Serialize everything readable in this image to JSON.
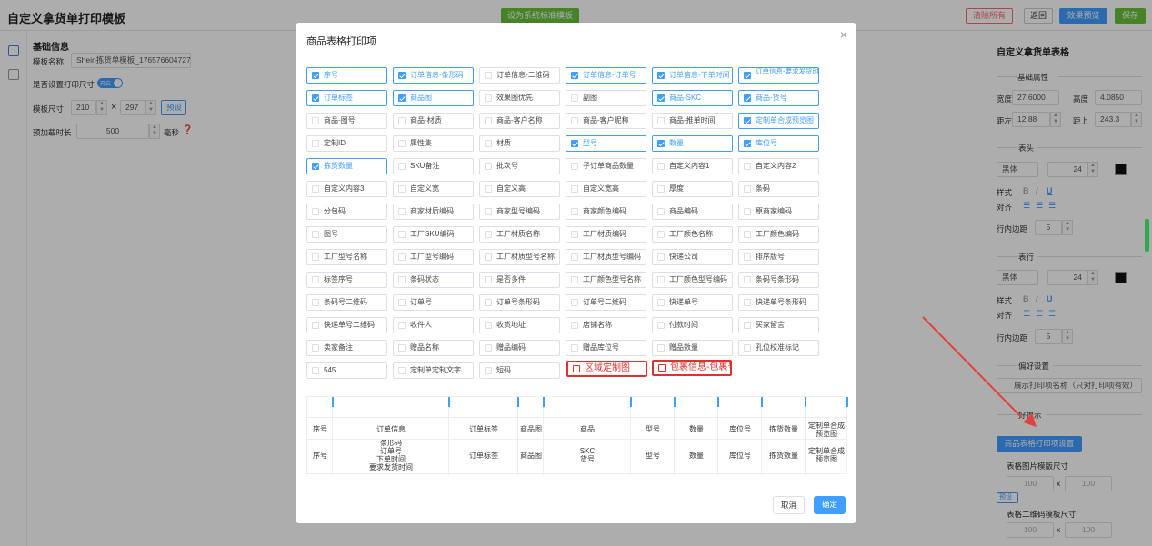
{
  "app": {
    "title": "自定义拿货单打印模板",
    "save_as_standard": "设为系统标准模板",
    "clear_all": "清除所有",
    "back": "返回",
    "preview": "效果预览",
    "save": "保存"
  },
  "left": {
    "section": "基础信息",
    "template_name_label": "模板名称",
    "template_name_value": "Shein拣货单模板_176576604727",
    "print_size_label": "是否设置打印尺寸",
    "toggle": "开启",
    "size_label": "模板尺寸",
    "width": "210",
    "height": "297",
    "preset": "预设",
    "preload_label": "预加载时长",
    "preload_value": "500",
    "ms": "毫秒"
  },
  "right": {
    "title": "自定义拿货单表格",
    "basic": "基础属性",
    "width_label": "宽度",
    "width_value": "27.6000",
    "height_label": "高度",
    "height_value": "4.0850",
    "left_label": "距左",
    "left_value": "12.88",
    "top_label": "距上",
    "top_value": "243.3",
    "header": "表头",
    "font": "黑体",
    "font_size": "24",
    "style_label": "样式",
    "align_label": "对齐",
    "padding_label": "行内边距",
    "padding_value": "5",
    "row": "表行",
    "pref": "偏好设置",
    "show_name": "展示打印项名称（只对打印项有效）",
    "hint": "好提示",
    "table_setting": "商品表格打印项设置",
    "img_size": "表格图片模版尺寸",
    "qr_size": "表格二维码模板尺寸",
    "w100": "100",
    "h100": "100",
    "x": "x",
    "preset": "预设"
  },
  "modal": {
    "title": "商品表格打印项",
    "close": "×",
    "cancel": "取消",
    "ok": "确定",
    "items": [
      {
        "label": "序号",
        "checked": true
      },
      {
        "label": "订单信息-条形码",
        "checked": true
      },
      {
        "label": "订单信息-二维码",
        "checked": false
      },
      {
        "label": "订单信息-订单号",
        "checked": true
      },
      {
        "label": "订单信息-下单时间",
        "checked": true
      },
      {
        "label": "订单信息-要求发货时间",
        "checked": true
      },
      {
        "label": "订单标签",
        "checked": true
      },
      {
        "label": "商品图",
        "checked": true
      },
      {
        "label": "效果图优先",
        "checked": false
      },
      {
        "label": "副图",
        "checked": false
      },
      {
        "label": "商品-SKC",
        "checked": true
      },
      {
        "label": "商品-货号",
        "checked": true
      },
      {
        "label": "商品-图号",
        "checked": false
      },
      {
        "label": "商品-材质",
        "checked": false
      },
      {
        "label": "商品-客户名称",
        "checked": false
      },
      {
        "label": "商品-客户昵称",
        "checked": false
      },
      {
        "label": "商品-推单时间",
        "checked": false
      },
      {
        "label": "定制单合成预览图",
        "checked": true
      },
      {
        "label": "定制ID",
        "checked": false
      },
      {
        "label": "属性集",
        "checked": false
      },
      {
        "label": "材质",
        "checked": false
      },
      {
        "label": "型号",
        "checked": true
      },
      {
        "label": "数量",
        "checked": true
      },
      {
        "label": "库位号",
        "checked": true
      },
      {
        "label": "拣货数量",
        "checked": true
      },
      {
        "label": "SKU备注",
        "checked": false
      },
      {
        "label": "批次号",
        "checked": false
      },
      {
        "label": "子订单商品数量",
        "checked": false
      },
      {
        "label": "自定义内容1",
        "checked": false
      },
      {
        "label": "自定义内容2",
        "checked": false
      },
      {
        "label": "自定义内容3",
        "checked": false
      },
      {
        "label": "自定义宽",
        "checked": false
      },
      {
        "label": "自定义高",
        "checked": false
      },
      {
        "label": "自定义宽高",
        "checked": false
      },
      {
        "label": "厚度",
        "checked": false
      },
      {
        "label": "条码",
        "checked": false
      },
      {
        "label": "分包码",
        "checked": false
      },
      {
        "label": "商家材质编码",
        "checked": false
      },
      {
        "label": "商家型号编码",
        "checked": false
      },
      {
        "label": "商家颜色编码",
        "checked": false
      },
      {
        "label": "商品编码",
        "checked": false
      },
      {
        "label": "原商家编码",
        "checked": false
      },
      {
        "label": "图号",
        "checked": false
      },
      {
        "label": "工厂SKU编码",
        "checked": false
      },
      {
        "label": "工厂材质名称",
        "checked": false
      },
      {
        "label": "工厂材质编码",
        "checked": false
      },
      {
        "label": "工厂颜色名称",
        "checked": false
      },
      {
        "label": "工厂颜色编码",
        "checked": false
      },
      {
        "label": "工厂型号名称",
        "checked": false
      },
      {
        "label": "工厂型号编码",
        "checked": false
      },
      {
        "label": "工厂材质型号名称",
        "checked": false
      },
      {
        "label": "工厂材质型号编码",
        "checked": false
      },
      {
        "label": "快递公司",
        "checked": false
      },
      {
        "label": "排序版号",
        "checked": false
      },
      {
        "label": "标签序号",
        "checked": false
      },
      {
        "label": "条码状态",
        "checked": false
      },
      {
        "label": "是否多件",
        "checked": false
      },
      {
        "label": "工厂颜色型号名称",
        "checked": false
      },
      {
        "label": "工厂颜色型号编码",
        "checked": false
      },
      {
        "label": "条码号条形码",
        "checked": false
      },
      {
        "label": "条码号二维码",
        "checked": false
      },
      {
        "label": "订单号",
        "checked": false
      },
      {
        "label": "订单号条形码",
        "checked": false
      },
      {
        "label": "订单号二维码",
        "checked": false
      },
      {
        "label": "快递单号",
        "checked": false
      },
      {
        "label": "快递单号条形码",
        "checked": false
      },
      {
        "label": "快递单号二维码",
        "checked": false
      },
      {
        "label": "收件人",
        "checked": false
      },
      {
        "label": "收货地址",
        "checked": false
      },
      {
        "label": "店铺名称",
        "checked": false
      },
      {
        "label": "付款时间",
        "checked": false
      },
      {
        "label": "买家留言",
        "checked": false
      },
      {
        "label": "卖家备注",
        "checked": false
      },
      {
        "label": "赠品名称",
        "checked": false
      },
      {
        "label": "赠品编码",
        "checked": false
      },
      {
        "label": "赠品库位号",
        "checked": false
      },
      {
        "label": "赠品数量",
        "checked": false
      },
      {
        "label": "孔位校准标记",
        "checked": false
      },
      {
        "label": "545",
        "checked": false
      },
      {
        "label": "定制单定制文字",
        "checked": false
      },
      {
        "label": "短码",
        "checked": false
      },
      {
        "label": "区域定制图",
        "checked": false
      },
      {
        "label": "包裹信息-包裹号",
        "checked": false
      }
    ],
    "preview_cols": [
      {
        "header": "序号",
        "cell": "序号"
      },
      {
        "header": "订单信息",
        "cell": "条形码\n订单号\n下单时间\n要求发货时间"
      },
      {
        "header": "订单标签",
        "cell": "订单标签"
      },
      {
        "header": "商品图",
        "cell": "商品图"
      },
      {
        "header": "商品",
        "cell": "SKC\n货号"
      },
      {
        "header": "型号",
        "cell": "型号"
      },
      {
        "header": "数量",
        "cell": "数量"
      },
      {
        "header": "库位号",
        "cell": "库位号"
      },
      {
        "header": "拣货数量",
        "cell": "拣货数量"
      },
      {
        "header": "定制单合成\n预览图",
        "cell": "定制单合成\n预览图"
      }
    ]
  }
}
